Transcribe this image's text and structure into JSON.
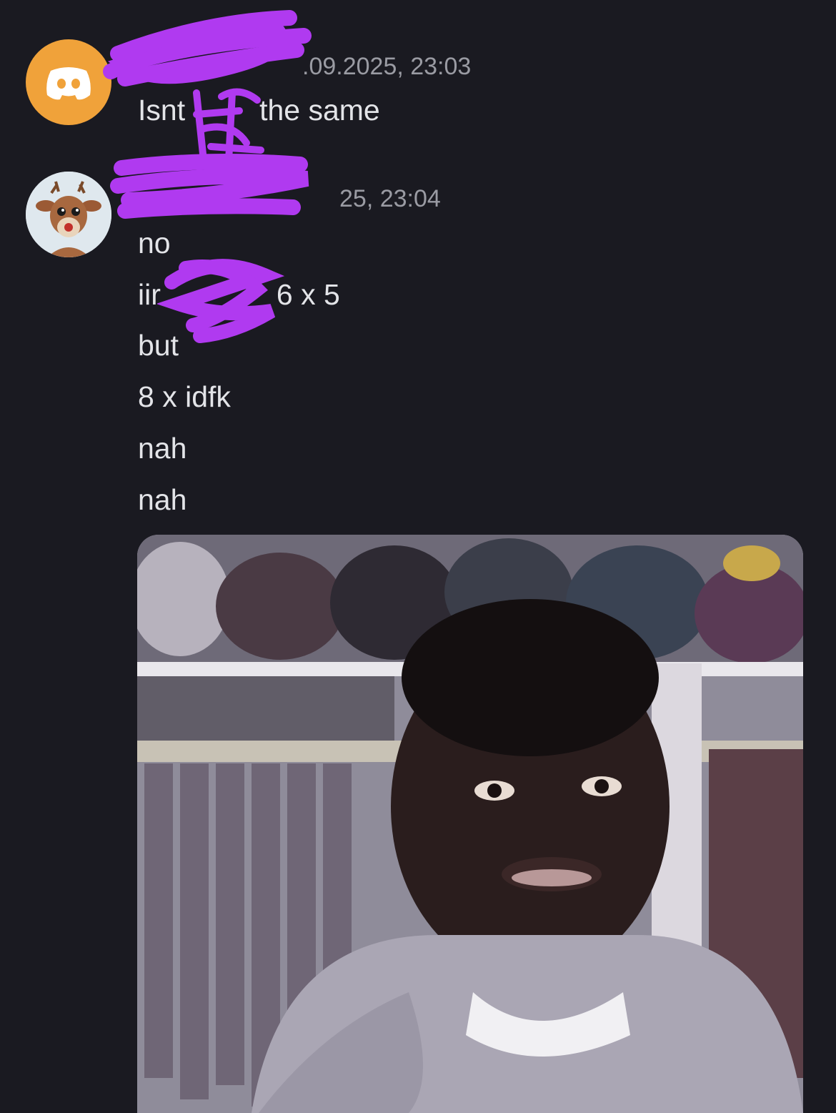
{
  "messages": [
    {
      "avatar_icon": "discord-logo-icon",
      "author": "",
      "timestamp": ".09.2025, 23:03",
      "lines": [
        "Isnt",
        "the same"
      ]
    },
    {
      "avatar_icon": "deer-avatar-icon",
      "author": "",
      "timestamp": "25, 23:04",
      "lines": [
        "no",
        "iir",
        "6 x 5",
        "but",
        "8 x idfk",
        "nah",
        "nah"
      ]
    }
  ],
  "attachment": {
    "type": "image",
    "subject": "man-reaction-photo"
  },
  "colors": {
    "background": "#1a1a21",
    "text": "#e3e4e8",
    "timestamp": "#9a9ba3",
    "scribble": "#b03af0",
    "discord_avatar": "#f0a23a"
  }
}
